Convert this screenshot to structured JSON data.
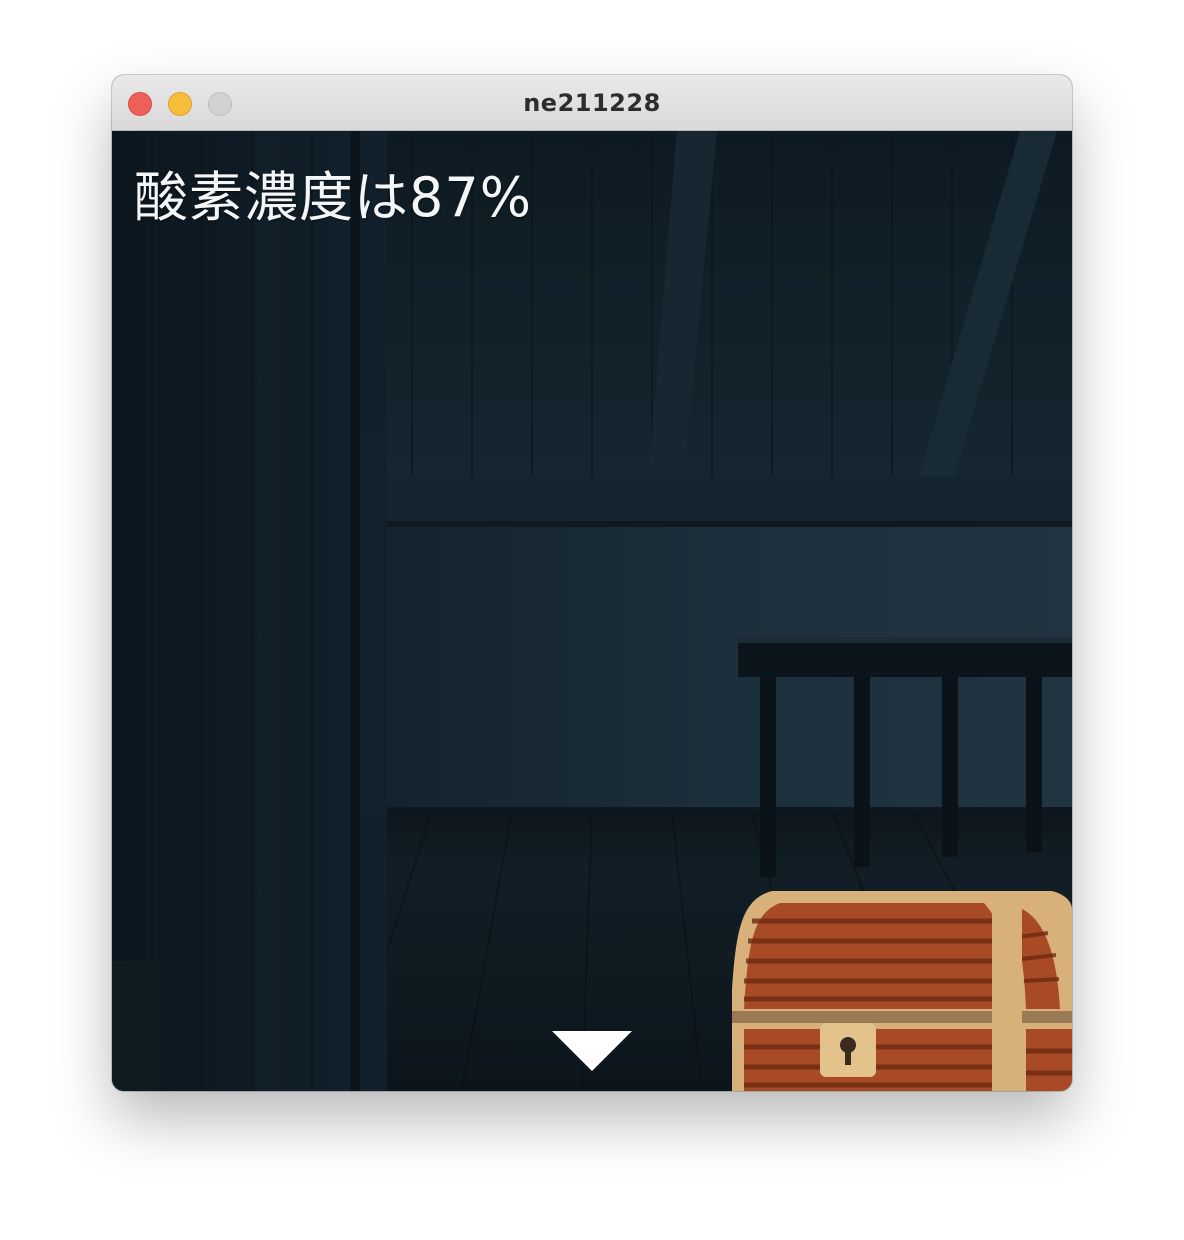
{
  "window": {
    "title": "ne211228"
  },
  "hud": {
    "oxygen_text": "酸素濃度は87%"
  },
  "scene": {
    "name": "attic-room"
  },
  "navigation": {
    "down_icon": "triangle-down-icon"
  },
  "colors": {
    "wall_dark": "#0e1a22",
    "wall_mid": "#1c2e3a",
    "chest_wood": "#a84a25",
    "chest_trim": "#d8b07a",
    "text": "#f4f6f7"
  }
}
